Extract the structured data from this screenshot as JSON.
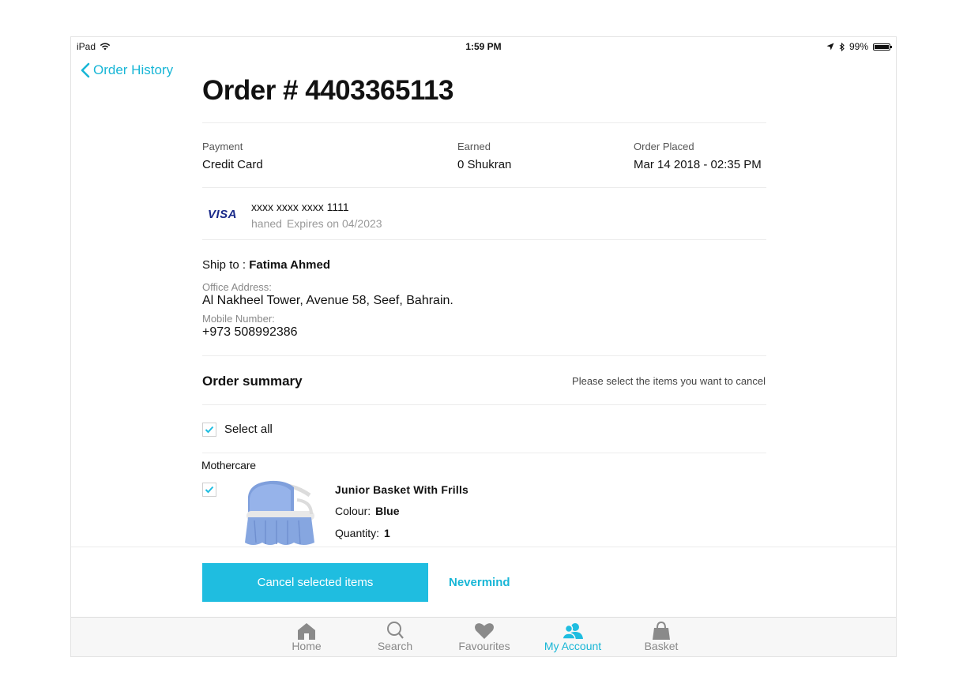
{
  "status_bar": {
    "device": "iPad",
    "time": "1:59 PM",
    "battery": "99%",
    "battery_level": 0.99
  },
  "nav": {
    "back_label": "Order History"
  },
  "order": {
    "title": "Order # 4403365113"
  },
  "meta": {
    "payment_label": "Payment",
    "payment_value": "Credit Card",
    "earned_label": "Earned",
    "earned_value": "0 Shukran",
    "placed_label": "Order Placed",
    "placed_value": "Mar 14 2018 - 02:35 PM"
  },
  "card": {
    "brand": "VISA",
    "number": "xxxx xxxx xxxx 1111",
    "holder": "haned",
    "expiry": "Expires on 04/2023"
  },
  "shipping": {
    "ship_to_label": "Ship to :",
    "name": "Fatima Ahmed",
    "address_label": "Office Address:",
    "address": "Al Nakheel Tower, Avenue 58, Seef, Bahrain.",
    "mobile_label": "Mobile Number:",
    "mobile": "+973 508992386"
  },
  "summary": {
    "title": "Order summary",
    "hint": "Please select the items you want to cancel",
    "select_all_label": "Select all"
  },
  "seller": {
    "brand": "Mothercare"
  },
  "item": {
    "name": "Junior Basket With Frills",
    "colour_label": "Colour:",
    "colour_value": "Blue",
    "quantity_label": "Quantity:",
    "quantity_value": "1"
  },
  "actions": {
    "cancel_label": "Cancel selected items",
    "nevermind_label": "Nevermind"
  },
  "tabs": [
    {
      "label": "Home",
      "icon": "home-icon"
    },
    {
      "label": "Search",
      "icon": "search-icon"
    },
    {
      "label": "Favourites",
      "icon": "heart-icon"
    },
    {
      "label": "My Account",
      "icon": "account-icon",
      "active": true
    },
    {
      "label": "Basket",
      "icon": "basket-icon"
    }
  ],
  "colors": {
    "accent": "#1fbde0",
    "text": "#111111",
    "muted": "#888888"
  }
}
